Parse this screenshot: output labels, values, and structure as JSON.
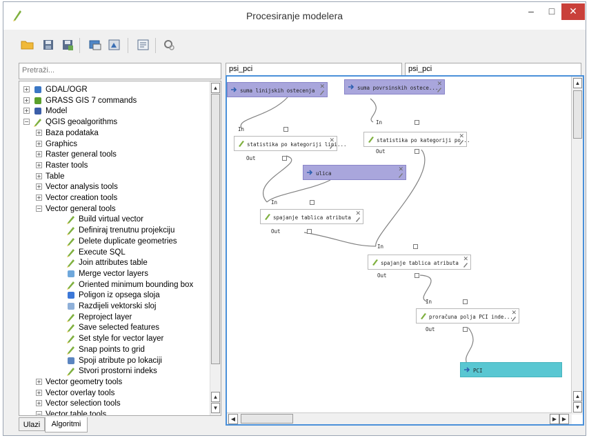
{
  "window": {
    "title": "Procesiranje modelera",
    "minimize": "–",
    "maximize": "□",
    "close": "✕"
  },
  "toolbar": [
    {
      "icon": "open-folder-icon"
    },
    {
      "icon": "save-icon"
    },
    {
      "icon": "save-as-icon"
    },
    {
      "icon": "export-image-icon"
    },
    {
      "icon": "export-python-icon"
    },
    {
      "icon": "edit-help-icon"
    },
    {
      "icon": "run-model-icon"
    }
  ],
  "sidebar": {
    "search_placeholder": "Pretraži...",
    "tree": [
      {
        "label": "GDAL/OGR",
        "level": 0,
        "expander": "+",
        "icon": "gdal-icon"
      },
      {
        "label": "GRASS GIS 7 commands",
        "level": 0,
        "expander": "+",
        "icon": "grass-icon"
      },
      {
        "label": "Model",
        "level": 0,
        "expander": "+",
        "icon": "model-icon"
      },
      {
        "label": "QGIS geoalgorithms",
        "level": 0,
        "expander": "−",
        "icon": "qgis-icon"
      },
      {
        "label": "Baza podataka",
        "level": 1,
        "expander": "+"
      },
      {
        "label": "Graphics",
        "level": 1,
        "expander": "+"
      },
      {
        "label": "Raster general tools",
        "level": 1,
        "expander": "+"
      },
      {
        "label": "Raster tools",
        "level": 1,
        "expander": "+"
      },
      {
        "label": "Table",
        "level": 1,
        "expander": "+"
      },
      {
        "label": "Vector analysis tools",
        "level": 1,
        "expander": "+"
      },
      {
        "label": "Vector creation tools",
        "level": 1,
        "expander": "+"
      },
      {
        "label": "Vector general tools",
        "level": 1,
        "expander": "−"
      },
      {
        "label": "Build virtual vector",
        "level": 2,
        "icon": "algorithm-icon"
      },
      {
        "label": "Definiraj trenutnu projekciju",
        "level": 2,
        "icon": "algorithm-icon"
      },
      {
        "label": "Delete duplicate geometries",
        "level": 2,
        "icon": "algorithm-icon"
      },
      {
        "label": "Execute SQL",
        "level": 2,
        "icon": "algorithm-icon"
      },
      {
        "label": "Join attributes table",
        "level": 2,
        "icon": "algorithm-icon"
      },
      {
        "label": "Merge vector layers",
        "level": 2,
        "icon": "merge-layers-icon"
      },
      {
        "label": "Oriented minimum bounding box",
        "level": 2,
        "icon": "algorithm-icon"
      },
      {
        "label": "Poligon iz opsega sloja",
        "level": 2,
        "icon": "extent-polygon-icon"
      },
      {
        "label": "Razdijeli vektorski sloj",
        "level": 2,
        "icon": "split-layer-icon"
      },
      {
        "label": "Reproject layer",
        "level": 2,
        "icon": "algorithm-icon"
      },
      {
        "label": "Save selected features",
        "level": 2,
        "icon": "algorithm-icon"
      },
      {
        "label": "Set style for vector layer",
        "level": 2,
        "icon": "algorithm-icon"
      },
      {
        "label": "Snap points to grid",
        "level": 2,
        "icon": "algorithm-icon"
      },
      {
        "label": "Spoji atribute po lokaciji",
        "level": 2,
        "icon": "join-location-icon"
      },
      {
        "label": "Stvori prostorni indeks",
        "level": 2,
        "icon": "algorithm-icon"
      },
      {
        "label": "Vector geometry tools",
        "level": 1,
        "expander": "+"
      },
      {
        "label": "Vector overlay tools",
        "level": 1,
        "expander": "+"
      },
      {
        "label": "Vector selection tools",
        "level": 1,
        "expander": "+"
      },
      {
        "label": "Vector table tools",
        "level": 1,
        "expander": "−"
      }
    ],
    "tabs": [
      {
        "label": "Ulazi",
        "active": false
      },
      {
        "label": "Algoritmi",
        "active": true
      }
    ]
  },
  "model_name": "psi_pci",
  "model_group": "psi_pci",
  "canvas": {
    "nodes": [
      {
        "id": "n1",
        "type": "input",
        "label": "suma linijskih ostecenja"
      },
      {
        "id": "n2",
        "type": "input",
        "label": "suma povrsinskih ostece..."
      },
      {
        "id": "n3",
        "type": "alg",
        "label": "statistika po kategoriji lini..."
      },
      {
        "id": "n4",
        "type": "alg",
        "label": "statistika po kategoriji po..."
      },
      {
        "id": "n5",
        "type": "input",
        "label": "ulica"
      },
      {
        "id": "n6",
        "type": "alg",
        "label": "spajanje tablica atributa"
      },
      {
        "id": "n7",
        "type": "alg",
        "label": "spajanje tablica atributa"
      },
      {
        "id": "n8",
        "type": "alg",
        "label": "proračuna polja PCI inde..."
      },
      {
        "id": "n9",
        "type": "output",
        "label": "PCI"
      }
    ],
    "port_in": "In",
    "port_out": "Out",
    "colors": {
      "input": "#a9a6dc",
      "output": "#59c7d2",
      "accent": "#4a90d9",
      "link": "#808080"
    }
  }
}
